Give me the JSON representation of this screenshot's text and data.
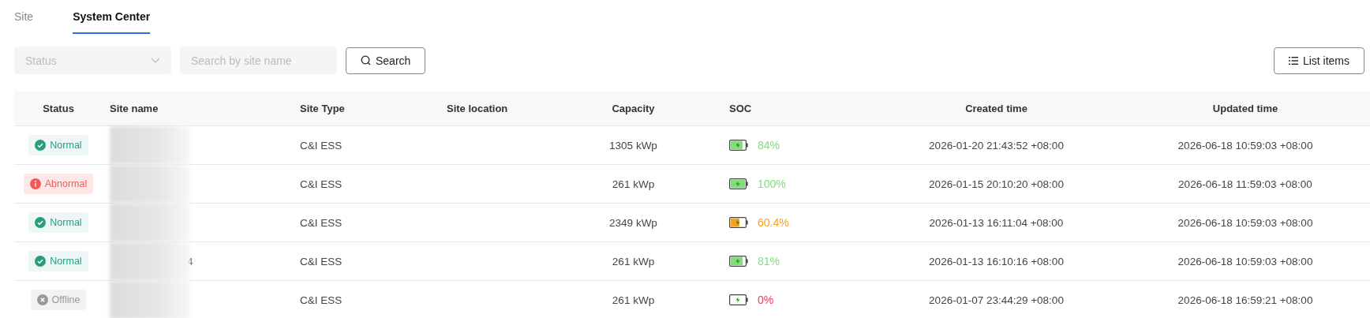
{
  "tabs": [
    {
      "label": "Site",
      "selected": false
    },
    {
      "label": "System Center",
      "selected": true
    }
  ],
  "filters": {
    "status": {
      "placeholder": "Status"
    },
    "search": {
      "placeholder": "Search by site name"
    },
    "search_button": "Search"
  },
  "list_button": "List items",
  "table": {
    "columns": [
      "Status",
      "Site name",
      "Site Type",
      "Site location",
      "Capacity",
      "SOC",
      "Created time",
      "Updated time"
    ],
    "rows": [
      {
        "status": {
          "kind": "normal",
          "label": "Normal"
        },
        "site_type": "C&I ESS",
        "capacity": "1305 kWp",
        "soc": {
          "kind": "high",
          "reading": "84%"
        },
        "created": "2026-01-20 21:43:52 +08:00",
        "updated": "2026-06-18 10:59:03 +08:00"
      },
      {
        "status": {
          "kind": "abnormal",
          "label": "Abnormal"
        },
        "site_type": "C&I ESS",
        "capacity": "261 kWp",
        "soc": {
          "kind": "full",
          "reading": "100%"
        },
        "created": "2026-01-15 20:10:20 +08:00",
        "updated": "2026-06-18 11:59:03 +08:00"
      },
      {
        "status": {
          "kind": "normal",
          "label": "Normal"
        },
        "site_type": "C&I ESS",
        "capacity": "2349 kWp",
        "soc": {
          "kind": "medium",
          "reading": "60.4%"
        },
        "created": "2026-01-13 16:11:04 +08:00",
        "updated": "2026-06-18 10:59:03 +08:00"
      },
      {
        "status": {
          "kind": "normal",
          "label": "Normal"
        },
        "site_name": "4",
        "site_type": "C&I ESS",
        "capacity": "261 kWp",
        "soc": {
          "kind": "high",
          "reading": "81%"
        },
        "created": "2026-01-13 16:10:16 +08:00",
        "updated": "2026-06-18 10:59:03 +08:00"
      },
      {
        "status": {
          "kind": "offline",
          "label": "Offline"
        },
        "site_type": "C&I ESS",
        "capacity": "261 kWp",
        "soc": {
          "kind": "empty",
          "reading": "0%"
        },
        "created": "2026-01-07 23:44:29 +08:00",
        "updated": "2026-06-18 16:59:21 +08:00"
      }
    ]
  }
}
